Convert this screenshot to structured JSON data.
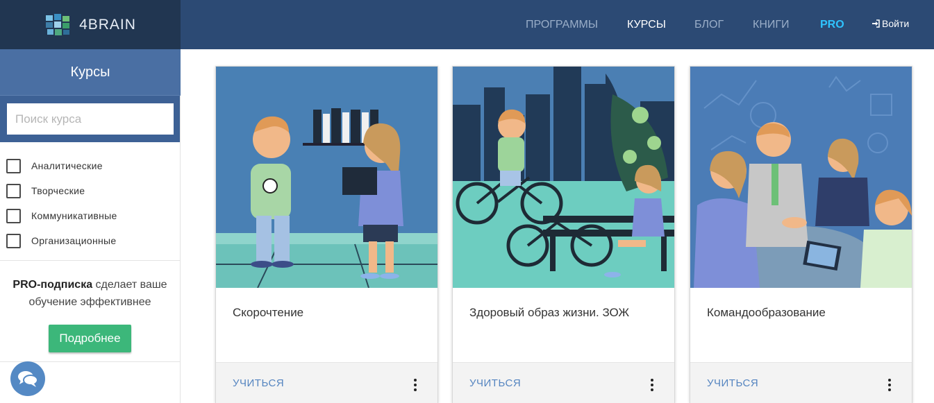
{
  "header": {
    "logo_text": "4BRAIN",
    "nav": [
      {
        "label": "ПРОГРАММЫ",
        "state": "default"
      },
      {
        "label": "КУРСЫ",
        "state": "active"
      },
      {
        "label": "БЛОГ",
        "state": "default"
      },
      {
        "label": "КНИГИ",
        "state": "default"
      },
      {
        "label": "PRO",
        "state": "pro"
      }
    ],
    "login_label": "Войти",
    "colors": {
      "bar": "#2c4a74",
      "logo_bg": "#213651",
      "pro": "#2fc3ff"
    }
  },
  "sidebar": {
    "title": "Курсы",
    "search_placeholder": "Поиск курса",
    "filters": [
      {
        "label": "Аналитические",
        "checked": false
      },
      {
        "label": "Творческие",
        "checked": false
      },
      {
        "label": "Коммуникативные",
        "checked": false
      },
      {
        "label": "Организационные",
        "checked": false
      }
    ],
    "pro_strong": "PRO-подписка",
    "pro_text": " сделает ваше обучение эффективнее",
    "more_button": "Подробнее",
    "chat_icon": "chat-bubbles-icon"
  },
  "cards": [
    {
      "title": "Скорочтение",
      "action": "УЧИТЬСЯ",
      "menu_icon": "more-vertical-icon",
      "illustration": "reading-people-illustration"
    },
    {
      "title": "Здоровый образ жизни. ЗОЖ",
      "action": "УЧИТЬСЯ",
      "menu_icon": "more-vertical-icon",
      "illustration": "cyclist-city-illustration"
    },
    {
      "title": "Командообразование",
      "action": "УЧИТЬСЯ",
      "menu_icon": "more-vertical-icon",
      "illustration": "team-handshake-illustration"
    }
  ]
}
